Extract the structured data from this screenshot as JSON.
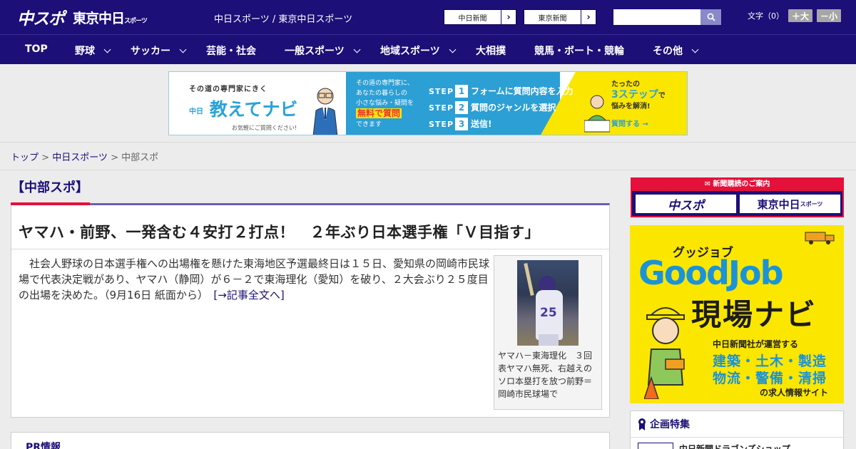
{
  "header": {
    "logo_main": "中スポ",
    "logo_tokyo": "東京中日",
    "logo_tokyo_suffix": "スポーツ",
    "site_link": "中日スポーツ / 東京中日スポーツ",
    "paper_buttons": [
      "中日新聞",
      "東京新聞"
    ],
    "search_placeholder": "",
    "font_label": "文字（0）",
    "font_larger": "＋大",
    "font_smaller": "－小"
  },
  "nav": {
    "items": [
      {
        "label": "TOP",
        "dropdown": false
      },
      {
        "label": "野球",
        "dropdown": true
      },
      {
        "label": "サッカー",
        "dropdown": true
      },
      {
        "label": "芸能・社会",
        "dropdown": false
      },
      {
        "label": "一般スポーツ",
        "dropdown": true
      },
      {
        "label": "地域スポーツ",
        "dropdown": true
      },
      {
        "label": "大相撲",
        "dropdown": false
      },
      {
        "label": "競馬・ボート・競輪",
        "dropdown": false
      },
      {
        "label": "その他",
        "dropdown": true
      }
    ]
  },
  "ad_banner": {
    "tagline": "その道の専門家にきく",
    "brand_prefix": "中日",
    "brand": "教えてナビ",
    "note": "お気軽にご質問ください!",
    "blue_lines": [
      "その道の専門家に、",
      "あなたの暮らしの",
      "小さな悩み・疑問を"
    ],
    "blue_highlight": "無料で質問",
    "blue_tail": "できます",
    "steps": [
      {
        "label": "STEP",
        "num": "1",
        "text": "フォームに質問内容を入力"
      },
      {
        "label": "STEP",
        "num": "2",
        "text": "質問のジャンルを選択"
      },
      {
        "label": "STEP",
        "num": "3",
        "text": "送信!"
      }
    ],
    "yellow_line1": "たったの",
    "yellow_big": "3ステップ",
    "yellow_line2": "で",
    "yellow_line3": "悩みを解消!",
    "yellow_button": "質問する →"
  },
  "breadcrumb": {
    "top": "トップ",
    "sep": " > ",
    "section": "中日スポーツ",
    "current": "中部スポ"
  },
  "main": {
    "section_title": "【中部スポ】",
    "headline": "ヤマハ・前野、一発含む４安打２打点！　２年ぶり日本選手権「Ｖ目指す」",
    "body": "社会人野球の日本選手権への出場権を懸けた東海地区予選最終日は１５日、愛知県の岡崎市民球場で代表決定戦があり、ヤマハ（静岡）が６－２で東海理化（愛知）を破り、２大会ぶり２５度目の出場を決めた。（9月16日 紙面から）",
    "read_more": "[→記事全文へ]",
    "photo_number": "25",
    "caption": "ヤマハ－東海理化　３回表ヤマハ無死、右越えのソロ本塁打を放つ前野＝岡崎市民球場で",
    "pr_title": "PR情報"
  },
  "sidebar": {
    "subscribe_head": "新聞購読のご案内",
    "sub_logo_a": "中スポ",
    "sub_logo_b": "東京中日",
    "sub_logo_b_suffix": "スポーツ",
    "gj_ruby": "グッジョブ",
    "gj_title": "GoodJob",
    "gj_sub": "現場ナビ",
    "gj_small": "中日新聞社が運営する",
    "gj_line1": "建築・土木・製造",
    "gj_line2": "物流・警備・清掃",
    "gj_foot": "の求人情報サイト",
    "feature_head": "企画特集",
    "feature_item": "中日新聞ドラゴンズショップ"
  },
  "colors": {
    "navy": "#1c0f77",
    "red": "#e4113a",
    "ad_blue": "#2c9fd5",
    "ad_yellow": "#fbe600"
  }
}
